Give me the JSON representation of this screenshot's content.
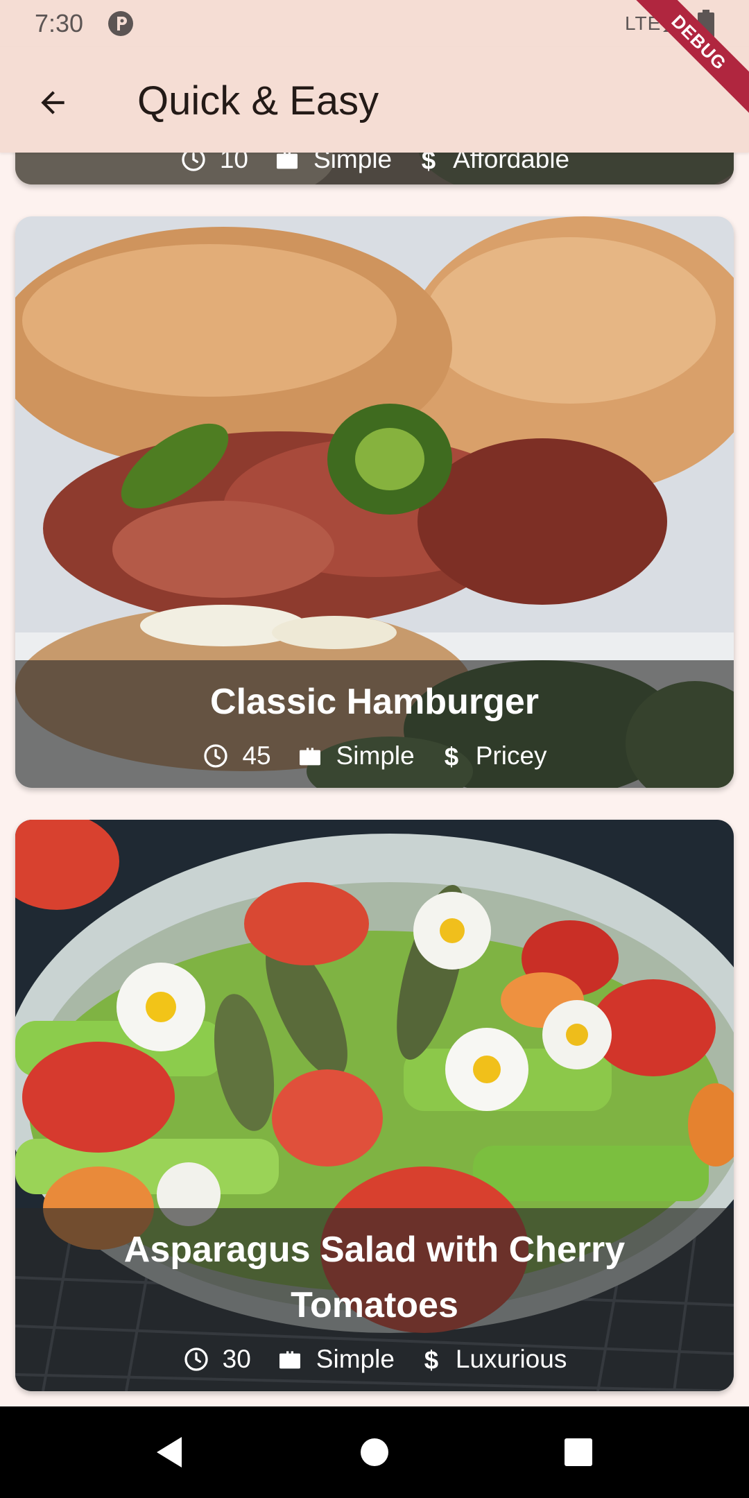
{
  "status_bar": {
    "time": "7:30",
    "network": "LTE",
    "icons": [
      "app-notification-icon",
      "signal-icon",
      "battery-icon"
    ]
  },
  "app_bar": {
    "title": "Quick & Easy",
    "back_icon": "arrow-back-icon"
  },
  "debug_banner": "DEBUG",
  "meals": [
    {
      "title": "",
      "duration": "10",
      "complexity": "Simple",
      "affordability": "Affordable"
    },
    {
      "title": "Classic Hamburger",
      "duration": "45",
      "complexity": "Simple",
      "affordability": "Pricey"
    },
    {
      "title": "Asparagus Salad with Cherry Tomatoes",
      "duration": "30",
      "complexity": "Simple",
      "affordability": "Luxurious"
    }
  ],
  "meta_icons": [
    "clock-icon",
    "briefcase-icon",
    "dollar-icon"
  ],
  "nav_bar": [
    "back-triangle-icon",
    "home-circle-icon",
    "recents-square-icon"
  ],
  "colors": {
    "background": "#fdf2ef",
    "app_bar": "#f5ddd4",
    "overlay": "#282828",
    "debug": "#b0263f"
  }
}
